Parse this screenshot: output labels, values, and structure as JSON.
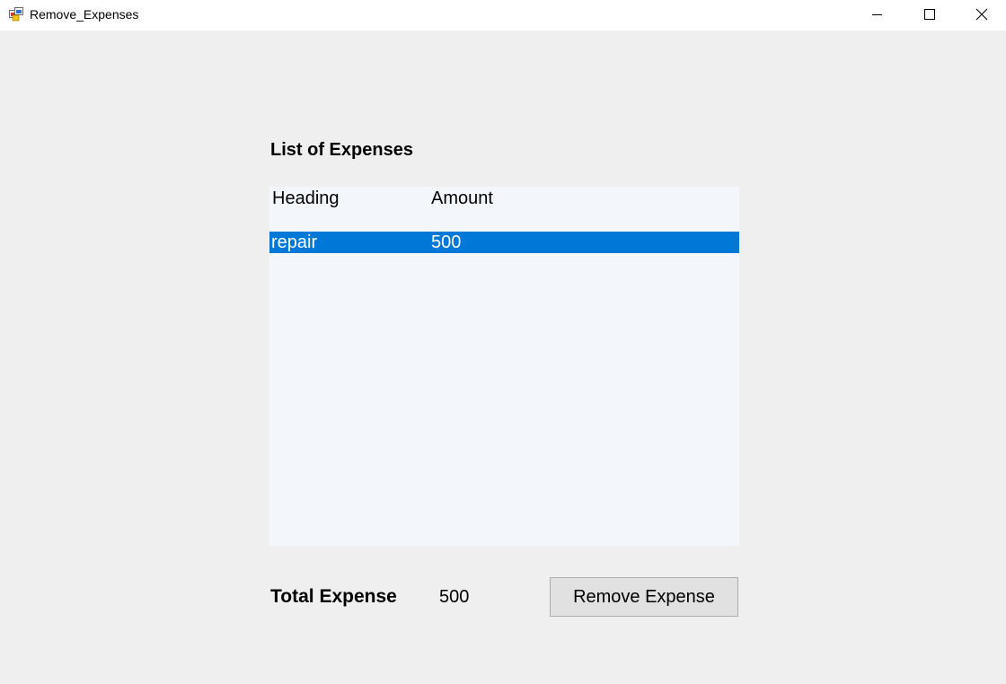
{
  "window": {
    "title": "Remove_Expenses",
    "icon": "winforms-app-icon",
    "controls": [
      "minimize-icon",
      "maximize-icon",
      "close-icon"
    ]
  },
  "list": {
    "title": "List of Expenses",
    "columns": [
      "Heading",
      "Amount"
    ],
    "rows": [
      {
        "heading": "repair",
        "amount": "500",
        "selected": true
      }
    ],
    "selection_color": "#0078d7",
    "background_color": "#f3f6fa"
  },
  "total": {
    "label": "Total Expense",
    "value": "500"
  },
  "actions": {
    "remove_label": "Remove Expense"
  }
}
